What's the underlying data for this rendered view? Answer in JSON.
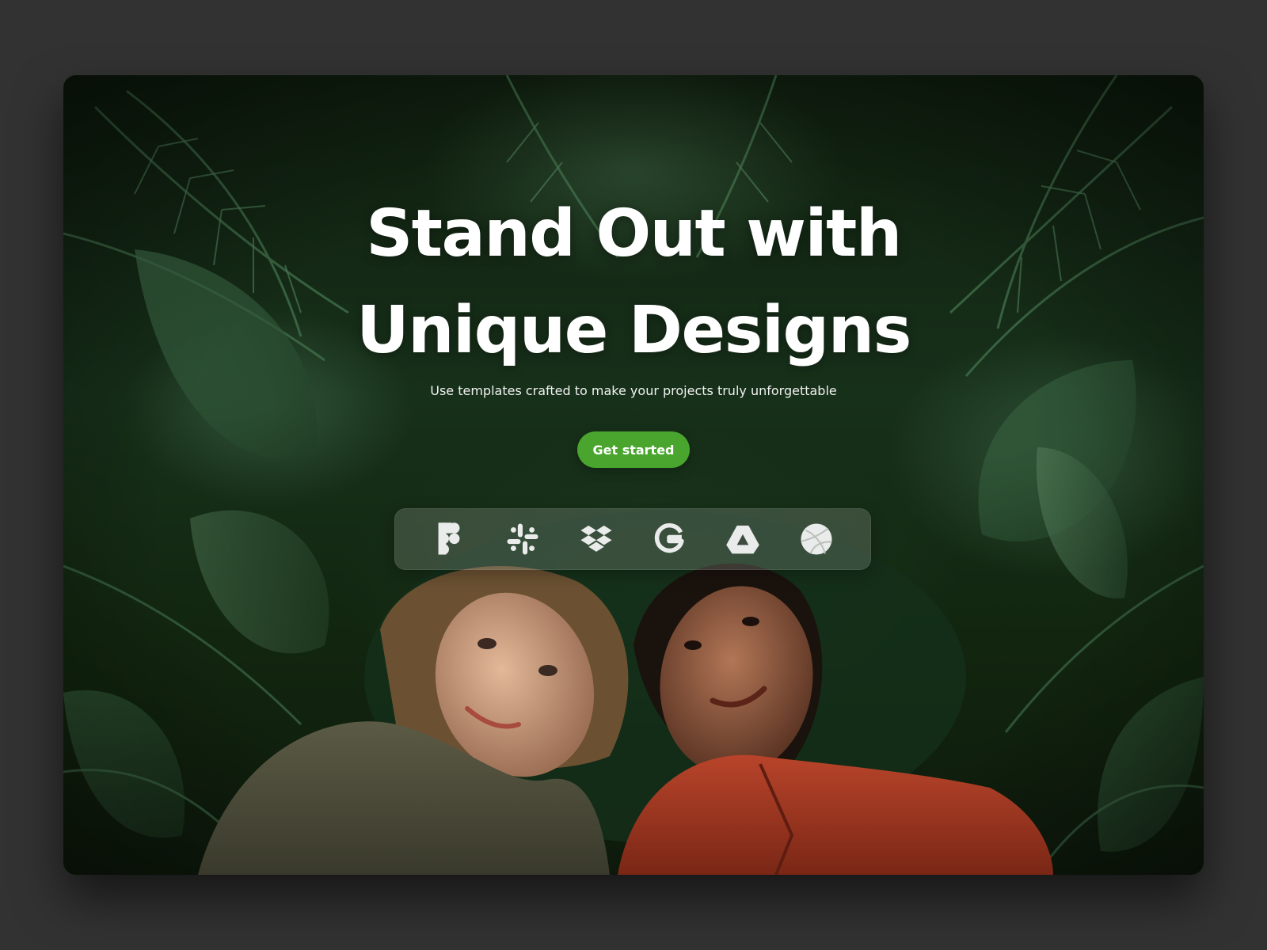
{
  "hero": {
    "headline_line1": "Stand Out with",
    "headline_line2": "Unique Designs",
    "subheadline": "Use templates crafted to make your projects truly unforgettable",
    "cta_label": "Get started",
    "accent_color": "#4aa52e"
  },
  "integrations": [
    {
      "icon": "figma-icon"
    },
    {
      "icon": "slack-icon"
    },
    {
      "icon": "dropbox-icon"
    },
    {
      "icon": "google-icon"
    },
    {
      "icon": "google-drive-icon"
    },
    {
      "icon": "dribbble-icon"
    }
  ]
}
